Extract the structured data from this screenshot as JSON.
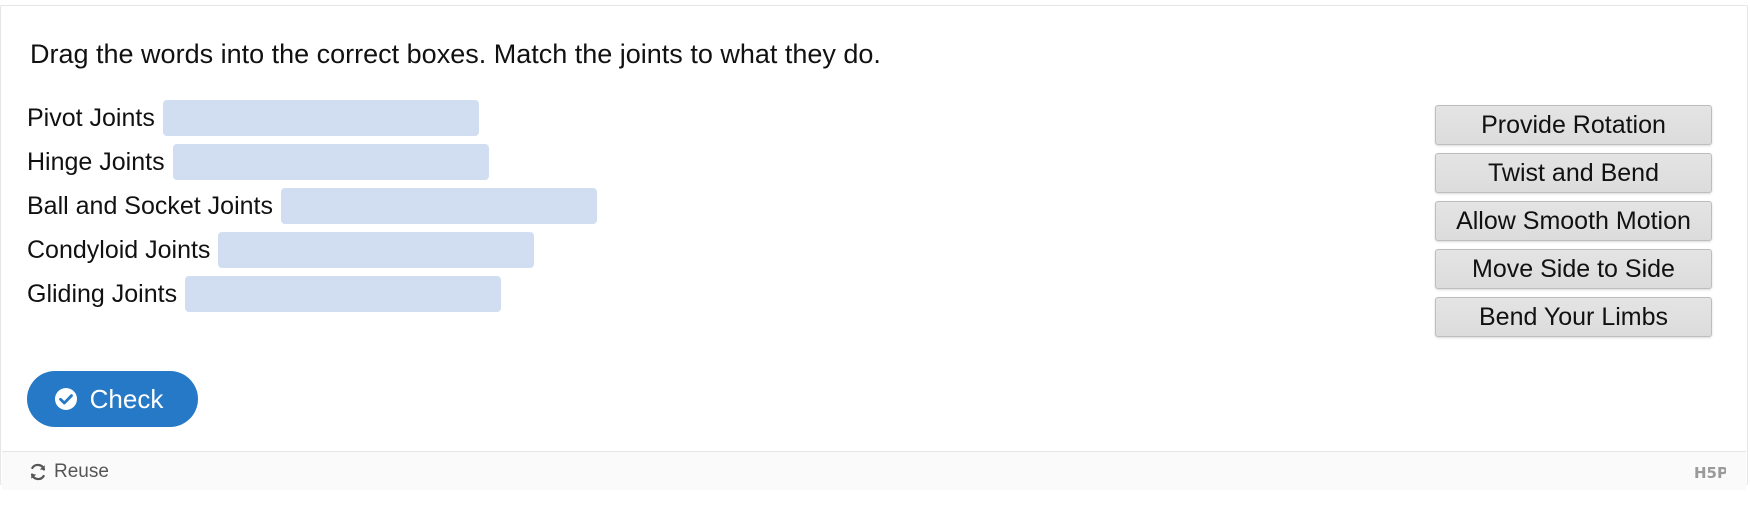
{
  "instructions": "Drag the words into the correct boxes. Match the joints to what they do.",
  "rows": [
    {
      "label": "Pivot Joints"
    },
    {
      "label": "Hinge Joints"
    },
    {
      "label": "Ball and Socket Joints"
    },
    {
      "label": "Condyloid Joints"
    },
    {
      "label": "Gliding Joints"
    }
  ],
  "words": [
    "Provide Rotation",
    "Twist and Bend",
    "Allow Smooth Motion",
    "Move Side to Side",
    "Bend Your Limbs"
  ],
  "check_button": {
    "label": "Check",
    "icon": "check-circle-icon",
    "color": "#2579c6"
  },
  "footer": {
    "reuse_label": "Reuse",
    "reuse_icon": "refresh-icon",
    "logo": "H5P"
  },
  "colors": {
    "dropzone": "#d1def1",
    "word_bg": "#e0e0e0"
  }
}
